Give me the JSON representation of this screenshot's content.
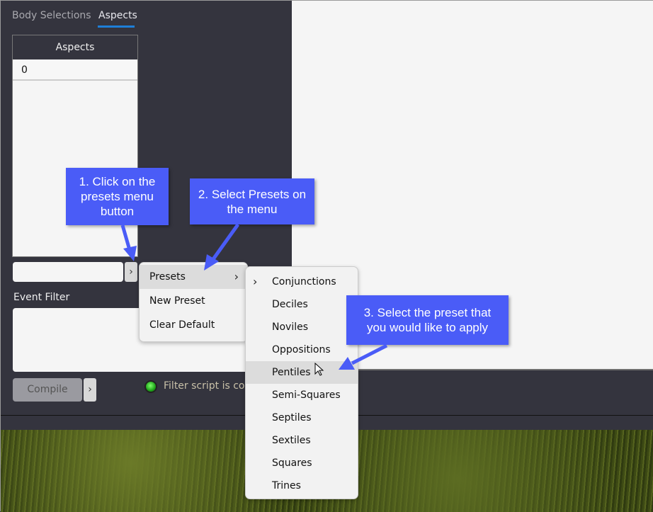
{
  "tabs": [
    {
      "label": "Body Selections",
      "active": false
    },
    {
      "label": "Aspects",
      "active": true
    }
  ],
  "aspects_table": {
    "header": "Aspects",
    "rows": [
      "0"
    ]
  },
  "preset_input": {
    "value": ""
  },
  "event_filter": {
    "label": "Event Filter",
    "value": ""
  },
  "compile": {
    "label": "Compile"
  },
  "status": {
    "text": "Filter script is compiled",
    "color": "#2ecc2e"
  },
  "menu": {
    "items": [
      {
        "label": "Presets",
        "has_submenu": true,
        "hovered": true
      },
      {
        "label": "New Preset"
      },
      {
        "label": "Clear Default"
      }
    ]
  },
  "submenu": {
    "items": [
      "Conjunctions",
      "Deciles",
      "Noviles",
      "Oppositions",
      "Pentiles",
      "Semi-Squares",
      "Septiles",
      "Sextiles",
      "Squares",
      "Trines"
    ],
    "hovered": "Pentiles",
    "expandable": "Conjunctions"
  },
  "callouts": [
    "1. Click on the presets menu button",
    "2. Select Presets on the menu",
    "3. Select the preset that you would like to apply"
  ],
  "colors": {
    "callout": "#4a5cf7",
    "panel": "#34343e",
    "tab_underline": "#1e7fd8"
  }
}
